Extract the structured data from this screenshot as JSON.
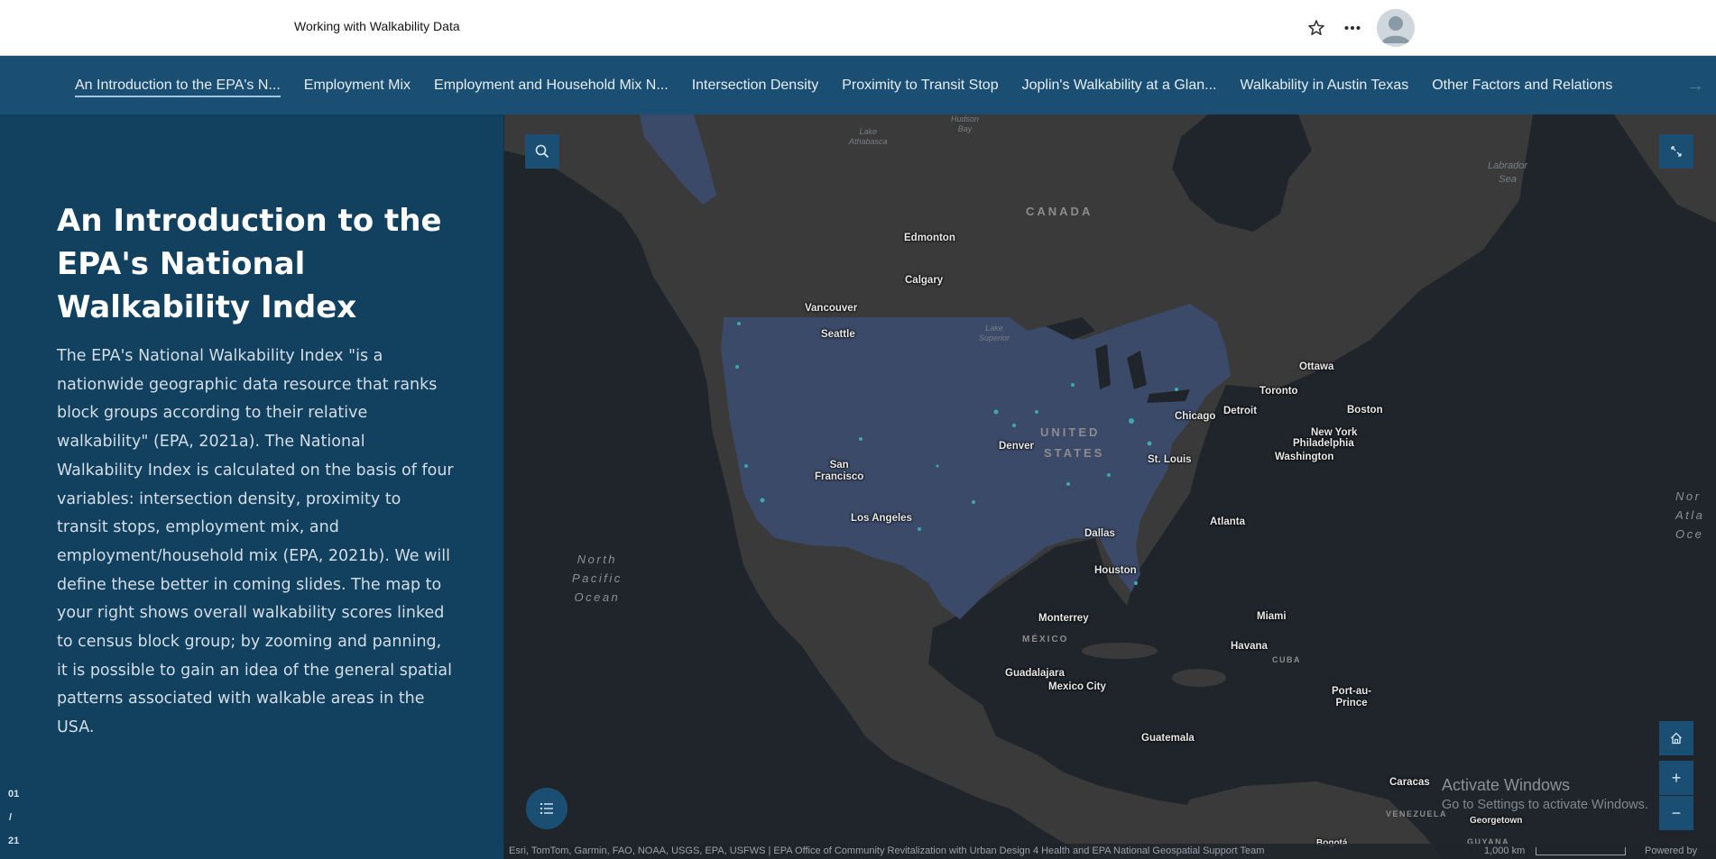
{
  "header": {
    "title": "Working with Walkability Data"
  },
  "tabs": [
    {
      "label": "An Introduction to the EPA's N...",
      "active": true
    },
    {
      "label": "Employment Mix"
    },
    {
      "label": "Employment and Household Mix N..."
    },
    {
      "label": "Intersection Density"
    },
    {
      "label": "Proximity to Transit Stop"
    },
    {
      "label": "Joplin's Walkability at a Glan..."
    },
    {
      "label": "Walkability in Austin Texas"
    },
    {
      "label": "Other Factors and Relations"
    }
  ],
  "tab_next_glyph": "→",
  "panel": {
    "title": "An Introduction to the EPA's National Walkability Index",
    "body": "The EPA's National Walkability Index \"is a nationwide geographic data resource that ranks block groups according to their relative walkability\" (EPA, 2021a). The National Walkability Index is calculated on the basis of four variables: intersection density, proximity to transit stops, employment mix, and employment/household mix (EPA, 2021b). We will define these better in coming slides. The map to your right shows overall walkability scores linked to census block group; by zooming and panning, it is possible to gain an idea of the general spatial patterns associated with walkable areas in the USA.",
    "counter": {
      "current": "01",
      "separator": "/",
      "total": "21"
    }
  },
  "map": {
    "cities": {
      "edmonton": "Edmonton",
      "calgary": "Calgary",
      "vancouver": "Vancouver",
      "seattle": "Seattle",
      "ottawa": "Ottawa",
      "toronto": "Toronto",
      "boston": "Boston",
      "chicago": "Chicago",
      "detroit": "Detroit",
      "new_york": "New York",
      "philadelphia": "Philadelphia",
      "washington": "Washington",
      "denver": "Denver",
      "st_louis": "St. Louis",
      "san_francisco": "San\nFrancisco",
      "los_angeles": "Los Angeles",
      "dallas": "Dallas",
      "atlanta": "Atlanta",
      "houston": "Houston",
      "monterrey": "Monterrey",
      "miami": "Miami",
      "havana": "Havana",
      "guadalajara": "Guadalajara",
      "mexico_city": "Mexico City",
      "port_au_prince": "Port-au-\nPrince",
      "guatemala": "Guatemala",
      "caracas": "Caracas",
      "georgetown": "Georgetown",
      "bogota": "Bogotá"
    },
    "countries": {
      "canada": "CANADA",
      "us_line1": "UNITED",
      "us_line2": "STATES",
      "mexico": "MÉXICO",
      "cuba": "CUBA",
      "venezuela": "VENEZUELA",
      "guyana": "GUYANA"
    },
    "water": {
      "north_pacific": "North\nPacific\nOcean",
      "north_atlantic": "Nor\nAtla\nOce",
      "hudson_bay": "Hudson\nBay",
      "labrador_sea": "Labrador\nSea",
      "lake_athabasca": "Lake\nAthabasca",
      "lake_superior": "Lake\nSuperior"
    },
    "attribution": "Esri, TomTom, Garmin, FAO, NOAA, USGS, EPA, USFWS | EPA Office of Community Revitalization with Urban Design 4 Health and EPA National Geospatial Support Team",
    "scale_label": "1,000 km",
    "powered_by": "Powered by Esri",
    "zoom_in": "+",
    "zoom_out": "−"
  },
  "watermark": {
    "line1": "Activate Windows",
    "line2": "Go to Settings to activate Windows."
  },
  "colors": {
    "header_bg": "#ffffff",
    "tabbar_bg": "#1a4f73",
    "panel_bg": "#12405f",
    "map_land": "#3a3a3a",
    "map_water": "#1f252b",
    "walkability_fill": "#3b4a68",
    "walkability_highlight": "#3fa6b3"
  }
}
